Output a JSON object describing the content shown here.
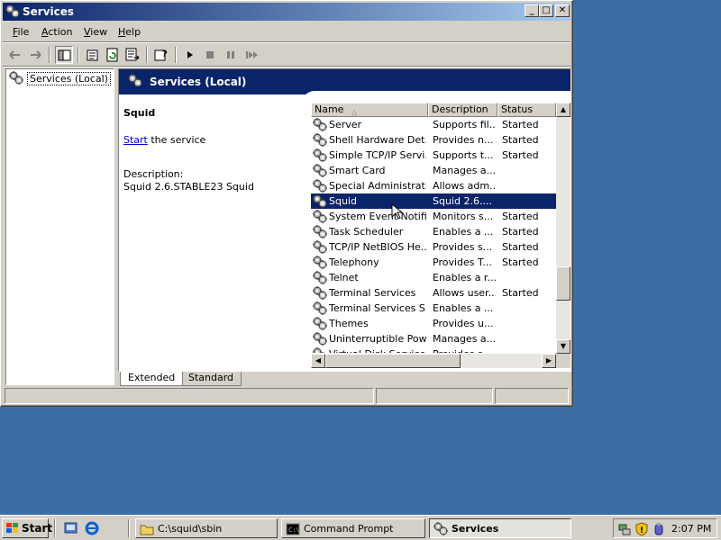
{
  "window": {
    "title": "Services",
    "controls": {
      "minimize": "_",
      "maximize": "□",
      "close": "✕"
    }
  },
  "menu": [
    {
      "label": "File",
      "accel": "F",
      "rest": "ile"
    },
    {
      "label": "Action",
      "accel": "A",
      "rest": "ction"
    },
    {
      "label": "View",
      "accel": "V",
      "rest": "iew"
    },
    {
      "label": "Help",
      "accel": "H",
      "rest": "elp"
    }
  ],
  "toolbar": {
    "icons": [
      "back-icon",
      "forward-icon",
      "show-hide-tree-icon",
      "properties-icon",
      "refresh-icon",
      "export-list-icon",
      "help-icon",
      "play-icon",
      "stop-icon",
      "pause-icon",
      "restart-icon"
    ]
  },
  "tree": {
    "root_label": "Services (Local)"
  },
  "pane_header": {
    "title": "Services (Local)"
  },
  "detail": {
    "service_name": "Squid",
    "start_link": "Start",
    "start_suffix": " the service",
    "description_label": "Description:",
    "description_text": "Squid 2.6.STABLE23 Squid"
  },
  "list": {
    "columns": {
      "name": "Name",
      "description": "Description",
      "status": "Status"
    },
    "sort_column": "name",
    "sort_direction": "ascending",
    "rows": [
      {
        "name": "Server",
        "description": "Supports fil...",
        "status": "Started"
      },
      {
        "name": "Shell Hardware Det...",
        "description": "Provides n...",
        "status": "Started"
      },
      {
        "name": "Simple TCP/IP Servi...",
        "description": "Supports t...",
        "status": "Started"
      },
      {
        "name": "Smart Card",
        "description": "Manages a...",
        "status": ""
      },
      {
        "name": "Special Administrati...",
        "description": "Allows adm...",
        "status": ""
      },
      {
        "name": "Squid",
        "description": "Squid 2.6....",
        "status": ""
      },
      {
        "name": "System Event Notifi...",
        "description": "Monitors s...",
        "status": "Started"
      },
      {
        "name": "Task Scheduler",
        "description": "Enables a ...",
        "status": "Started"
      },
      {
        "name": "TCP/IP NetBIOS He...",
        "description": "Provides s...",
        "status": "Started"
      },
      {
        "name": "Telephony",
        "description": "Provides T...",
        "status": "Started"
      },
      {
        "name": "Telnet",
        "description": "Enables a r...",
        "status": ""
      },
      {
        "name": "Terminal Services",
        "description": "Allows user...",
        "status": "Started"
      },
      {
        "name": "Terminal Services S...",
        "description": "Enables a ...",
        "status": ""
      },
      {
        "name": "Themes",
        "description": "Provides u...",
        "status": ""
      },
      {
        "name": "Uninterruptible Pow...",
        "description": "Manages a...",
        "status": ""
      },
      {
        "name": "Virtual Disk Service",
        "description": "Provides s...",
        "status": ""
      }
    ],
    "selected_row": 5
  },
  "tabs": [
    {
      "label": "Extended",
      "active": true
    },
    {
      "label": "Standard",
      "active": false
    }
  ],
  "taskbar": {
    "start_label": "Start",
    "quick_launch": [
      "show-desktop-icon",
      "internet-explorer-icon"
    ],
    "tasks": [
      {
        "label": "C:\\squid\\sbin",
        "icon": "folder-icon",
        "active": false
      },
      {
        "label": "Command Prompt",
        "icon": "command-prompt-icon",
        "active": false
      },
      {
        "label": "Services",
        "icon": "services-gear-icon",
        "active": true
      }
    ],
    "tray_icons": [
      "network-icon",
      "security-shield-icon",
      "volume-icon"
    ],
    "clock": "2:07 PM"
  },
  "colors": {
    "desktop": "#3a6ea5",
    "titlebar_start": "#0a246a",
    "titlebar_end": "#a6caf0",
    "selection": "#0a246a",
    "face": "#d4d0c8",
    "link": "#0000cc"
  }
}
